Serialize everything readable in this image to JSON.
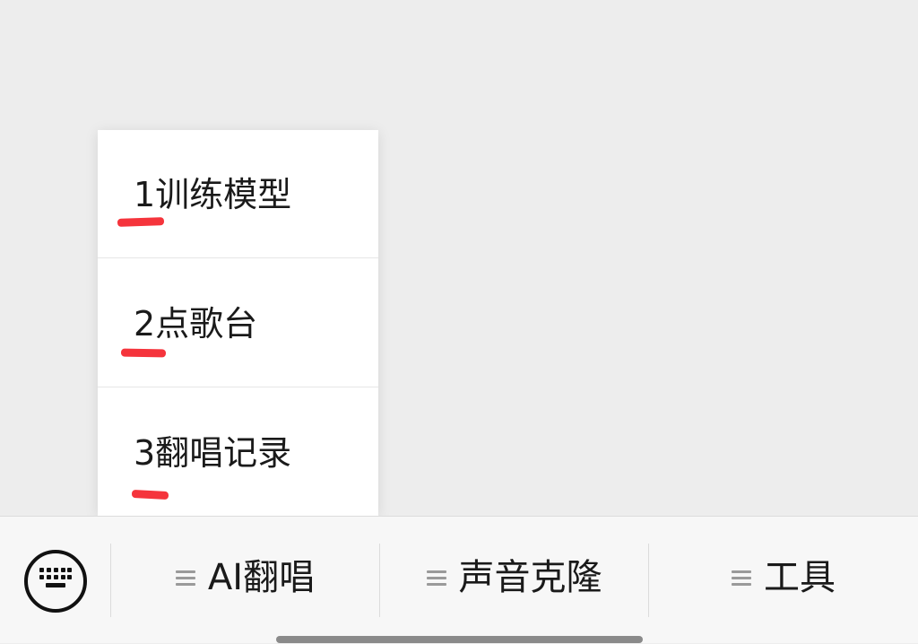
{
  "popup_menu": {
    "items": [
      {
        "label": "1训练模型"
      },
      {
        "label": "2点歌台"
      },
      {
        "label": "3翻唱记录"
      }
    ]
  },
  "bottom_bar": {
    "keyboard_icon": "keyboard-icon",
    "tabs": [
      {
        "label": "AI翻唱",
        "icon": "menu-icon"
      },
      {
        "label": "声音克隆",
        "icon": "menu-icon"
      },
      {
        "label": "工具",
        "icon": "menu-icon"
      }
    ]
  },
  "colors": {
    "background": "#ededed",
    "bar_background": "#f7f7f7",
    "annotation_red": "#f5343c"
  }
}
